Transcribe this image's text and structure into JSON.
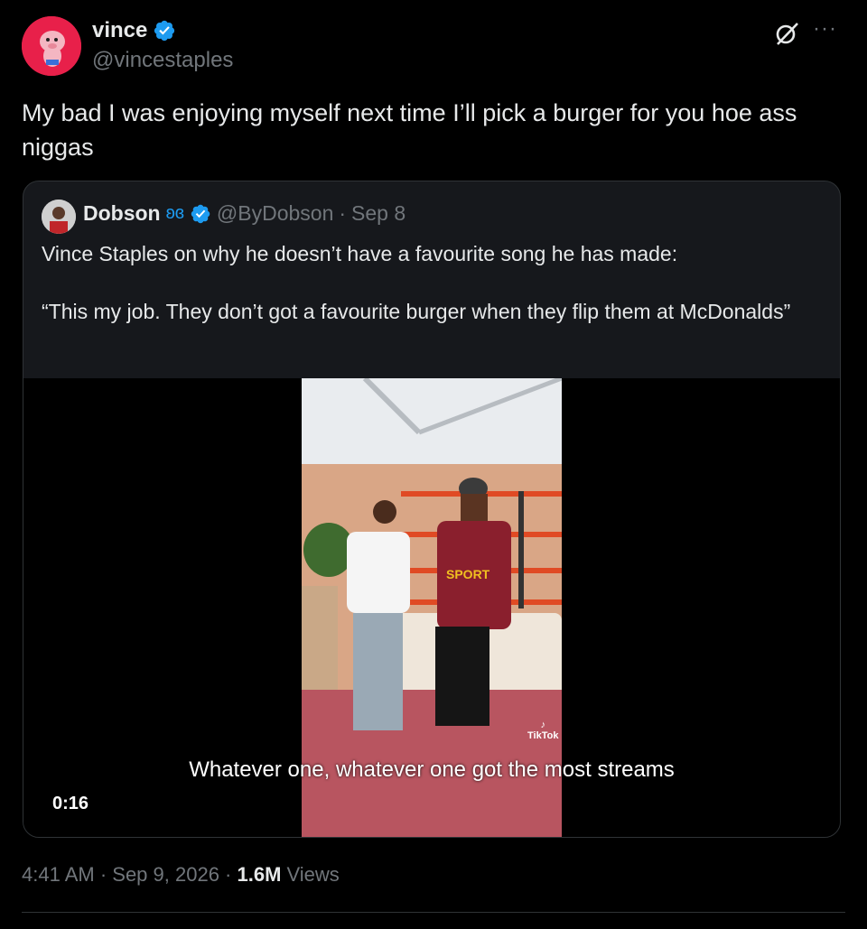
{
  "tweet": {
    "author_name": "vince",
    "author_handle": "@vincestaples",
    "text": "My bad I was enjoying myself next time I’ll pick a burger for you hoe ass niggas",
    "timestamp": "4:41 AM · Sep 9, 2026 · ",
    "views_count": "1.6M",
    "views_label": " Views"
  },
  "quote": {
    "author_name": "Dobson",
    "author_handle": "@ByDobson",
    "separator": "·",
    "date": "Sep 8",
    "text": "Vince Staples on why he doesn’t have a favourite song he has made:\n\n“This my job. They don’t got a favourite burger when they flip them at McDonalds”",
    "video": {
      "caption": "Whatever one, whatever one got the most streams",
      "duration": "0:16",
      "watermark": "TikTok"
    }
  },
  "colors": {
    "background": "#000000",
    "text_primary": "#e7e9ea",
    "text_secondary": "#71767b",
    "verified": "#1d9bf0",
    "card_border": "#2f3336"
  },
  "icons": [
    "verified-badge-icon",
    "grok-icon",
    "more-icon",
    "butterfly-icon"
  ]
}
